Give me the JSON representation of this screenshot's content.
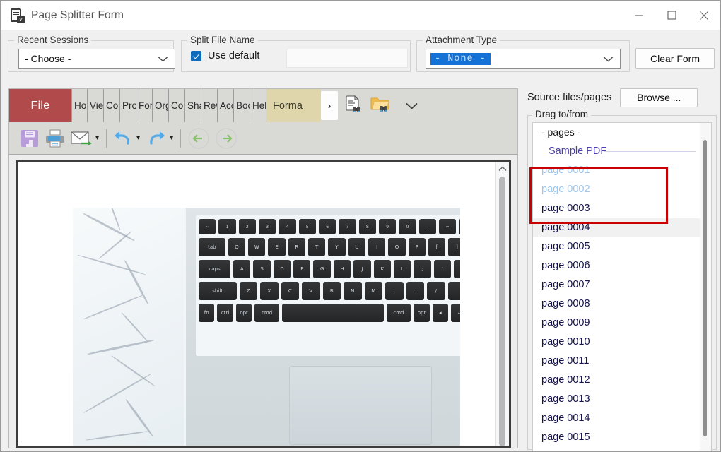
{
  "window": {
    "title": "Page Splitter Form",
    "icon": "pdf-form-icon",
    "minimize_label": "minimize-icon",
    "maximize_label": "maximize-icon",
    "close_label": "close-icon"
  },
  "form": {
    "recent_sessions": {
      "group_label": "Recent Sessions",
      "selected": "- Choose -",
      "chevron": "chevron-down-icon"
    },
    "split_file_name": {
      "group_label": "Split File Name",
      "use_default_label": "Use default",
      "use_default_checked": true,
      "filename_value": "",
      "filename_placeholder": ""
    },
    "attachment_type": {
      "group_label": "Attachment Type",
      "selected": "-  None  -",
      "chevron": "chevron-down-icon"
    },
    "clear_form_label": "Clear Form"
  },
  "viewer": {
    "file_tab": "File",
    "tabs": [
      "Hom",
      "View",
      "Com",
      "Pro",
      "For",
      "Org",
      "Con",
      "Sha",
      "Rev",
      "Acc",
      "Boo",
      "Hel"
    ],
    "format_tab": "Forma",
    "more_tabs": "›",
    "ribbon_icons": [
      "find-in-document-icon",
      "find-in-folder-icon",
      "chevron-down-icon"
    ],
    "toolbar_icons": [
      "save-icon",
      "print-icon",
      "email-icon",
      "email-dropdown-icon",
      "undo-icon",
      "undo-dropdown-icon",
      "redo-icon",
      "redo-dropdown-icon",
      "back-icon",
      "forward-icon"
    ],
    "scrollbar": {
      "up_arrow": "chevron-up-icon"
    },
    "preview_image": "laptop-keyboard-on-marble-photo"
  },
  "source_panel": {
    "header_label": "Source files/pages",
    "browse_label": "Browse ...",
    "group_label": "Drag to/from",
    "items": [
      {
        "label": "- pages -",
        "kind": "header"
      },
      {
        "label": "Sample PDF",
        "kind": "group"
      },
      {
        "label": "page 0001",
        "kind": "faded"
      },
      {
        "label": "page 0002",
        "kind": "faded"
      },
      {
        "label": "page 0003",
        "kind": "page"
      },
      {
        "label": "page 0004",
        "kind": "page-hover"
      },
      {
        "label": "page 0005",
        "kind": "page"
      },
      {
        "label": "page 0006",
        "kind": "page"
      },
      {
        "label": "page 0007",
        "kind": "page"
      },
      {
        "label": "page 0008",
        "kind": "page"
      },
      {
        "label": "page 0009",
        "kind": "page"
      },
      {
        "label": "page 0010",
        "kind": "page"
      },
      {
        "label": "page 0011",
        "kind": "page"
      },
      {
        "label": "page 0012",
        "kind": "page"
      },
      {
        "label": "page 0013",
        "kind": "page"
      },
      {
        "label": "page 0014",
        "kind": "page"
      },
      {
        "label": "page 0015",
        "kind": "page"
      }
    ]
  },
  "annotation": {
    "name": "red-highlight-box",
    "color": "#cc0000"
  },
  "colors": {
    "file_tab": "#b14a4a",
    "format_tab": "#e0d6ab",
    "accent_blue": "#1472d6",
    "checkbox_blue": "#0f6cbd",
    "group_header": "#4b3fa8",
    "faded_page": "#9dc6ee",
    "annotation_red": "#cc0000"
  }
}
